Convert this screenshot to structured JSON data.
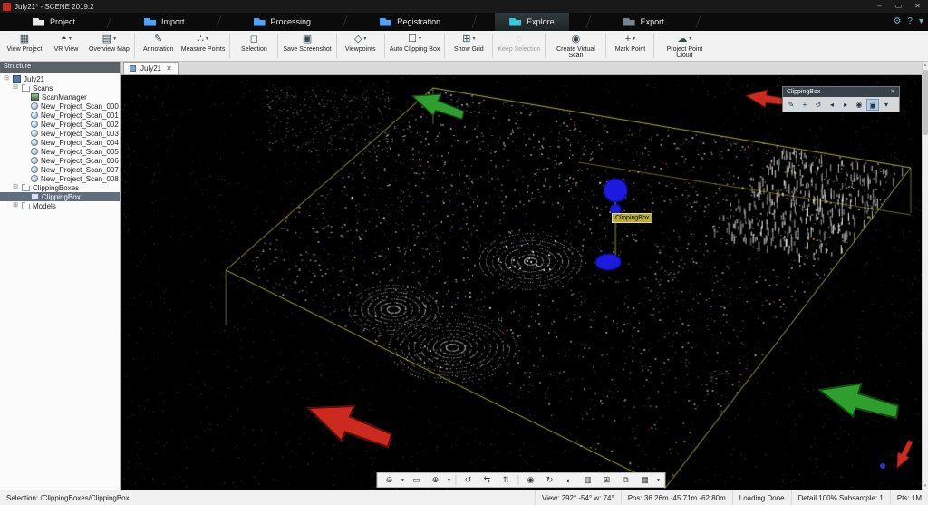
{
  "window": {
    "title": "July21* - SCENE 2019.2",
    "controls": {
      "minimize": "–",
      "maximize": "▭",
      "close": "✕"
    }
  },
  "colors": {
    "accent_cyan": "#35c8dc",
    "tab_blue": "#4da3ff",
    "arrow_green": "#2f9e2f",
    "arrow_red": "#cc2a1e",
    "clip_outline": "#cfcf4a",
    "marker_blue": "#1a1ae0",
    "selection_row": "#5f6f7d"
  },
  "ribbon": {
    "tabs": [
      {
        "label": "Project",
        "icon": "project-folder-icon",
        "accent": "#e8e8e8",
        "active": false
      },
      {
        "label": "Import",
        "icon": "import-icon",
        "accent": "#4da3ff",
        "active": false
      },
      {
        "label": "Processing",
        "icon": "processing-icon",
        "accent": "#4da3ff",
        "active": false
      },
      {
        "label": "Registration",
        "icon": "registration-icon",
        "accent": "#4da3ff",
        "active": false
      },
      {
        "label": "Explore",
        "icon": "explore-icon",
        "accent": "#35c8dc",
        "active": true
      },
      {
        "label": "Export",
        "icon": "export-icon",
        "accent": "#75828a",
        "active": false
      }
    ],
    "right_icons": [
      {
        "name": "settings-gear-icon",
        "glyph": "⚙"
      },
      {
        "name": "help-icon",
        "glyph": "?"
      },
      {
        "name": "collapse-ribbon-icon",
        "glyph": "▾"
      }
    ]
  },
  "toolbar": {
    "items": [
      {
        "label": "View Project",
        "icon": "view-project-icon",
        "glyph": "▦"
      },
      {
        "label": "VR View",
        "icon": "vr-view-icon",
        "glyph": "◓",
        "dropdown": true
      },
      {
        "label": "Overview Map",
        "icon": "overview-map-icon",
        "glyph": "▤",
        "dropdown": true
      },
      {
        "sep": true
      },
      {
        "label": "Annotation",
        "icon": "annotation-icon",
        "glyph": "✎"
      },
      {
        "label": "Measure Points",
        "icon": "measure-points-icon",
        "glyph": "∴",
        "dropdown": true
      },
      {
        "sep": true
      },
      {
        "label": "Selection",
        "icon": "selection-icon",
        "glyph": "◻"
      },
      {
        "sep": true
      },
      {
        "label": "Save Screenshot",
        "icon": "save-screenshot-icon",
        "glyph": "▣"
      },
      {
        "sep": true
      },
      {
        "label": "Viewpoints",
        "icon": "viewpoints-icon",
        "glyph": "◇",
        "dropdown": true
      },
      {
        "sep": true
      },
      {
        "label": "Auto Clipping Box",
        "icon": "auto-clipping-box-icon",
        "glyph": "☐",
        "dropdown": true
      },
      {
        "sep": true
      },
      {
        "label": "Show Grid",
        "icon": "show-grid-icon",
        "glyph": "⊞",
        "dropdown": true
      },
      {
        "sep": true
      },
      {
        "label": "Keep Selection",
        "icon": "keep-selection-icon",
        "glyph": "◌",
        "disabled": true
      },
      {
        "sep": true
      },
      {
        "label": "Create Virtual Scan",
        "icon": "create-virtual-scan-icon",
        "glyph": "◉"
      },
      {
        "sep": true
      },
      {
        "label": "Mark Point",
        "icon": "mark-point-icon",
        "glyph": "+",
        "dropdown": true
      },
      {
        "sep": true
      },
      {
        "label": "Project Point Cloud",
        "icon": "project-point-cloud-icon",
        "glyph": "☁",
        "dropdown": true
      }
    ]
  },
  "sidebar": {
    "title": "Structure",
    "tree": [
      {
        "label": "July21",
        "level": 0,
        "icon": "project-icon",
        "expander": "⊟"
      },
      {
        "label": "Scans",
        "level": 1,
        "icon": "folder-icon",
        "expander": "⊟"
      },
      {
        "label": "ScanManager",
        "level": 2,
        "icon": "scan-manager-icon"
      },
      {
        "label": "New_Project_Scan_000",
        "level": 2,
        "icon": "scan-icon"
      },
      {
        "label": "New_Project_Scan_001",
        "level": 2,
        "icon": "scan-icon"
      },
      {
        "label": "New_Project_Scan_002",
        "level": 2,
        "icon": "scan-icon"
      },
      {
        "label": "New_Project_Scan_003",
        "level": 2,
        "icon": "scan-icon"
      },
      {
        "label": "New_Project_Scan_004",
        "level": 2,
        "icon": "scan-icon"
      },
      {
        "label": "New_Project_Scan_005",
        "level": 2,
        "icon": "scan-icon"
      },
      {
        "label": "New_Project_Scan_006",
        "level": 2,
        "icon": "scan-icon"
      },
      {
        "label": "New_Project_Scan_007",
        "level": 2,
        "icon": "scan-icon"
      },
      {
        "label": "New_Project_Scan_008",
        "level": 2,
        "icon": "scan-icon"
      },
      {
        "label": "ClippingBoxes",
        "level": 1,
        "icon": "folder-icon",
        "expander": "⊟"
      },
      {
        "label": "ClippingBox",
        "level": 2,
        "icon": "clipping-box-icon",
        "selected": true
      },
      {
        "label": "Models",
        "level": 1,
        "icon": "folder-icon",
        "expander": "⊞"
      }
    ]
  },
  "viewport": {
    "tab": {
      "label": "July21",
      "close": "✕"
    },
    "marker_label": "ClippingBox",
    "clipping_panel": {
      "title": "ClippingBox",
      "close": "✕",
      "icons": [
        {
          "name": "edit-clipping-icon",
          "glyph": "✎"
        },
        {
          "name": "translate-clipping-icon",
          "glyph": "+"
        },
        {
          "name": "rotate-clipping-icon",
          "glyph": "↺"
        },
        {
          "name": "prev-face-icon",
          "glyph": "◂"
        },
        {
          "name": "next-face-icon",
          "glyph": "▸"
        },
        {
          "name": "visibility-icon",
          "glyph": "◉"
        },
        {
          "name": "apply-clipping-icon",
          "glyph": "▣",
          "hl": true
        },
        {
          "name": "panel-menu-icon",
          "glyph": "▾"
        }
      ]
    },
    "nav_toolbar": [
      {
        "name": "zoom-out-icon",
        "glyph": "⊖"
      },
      {
        "name": "zoom-mode-dropdown",
        "glyph": "▾",
        "caret": true
      },
      {
        "name": "fit-view-icon",
        "glyph": "▭"
      },
      {
        "name": "zoom-in-icon",
        "glyph": "⊕"
      },
      {
        "name": "zoom-window-dropdown",
        "glyph": "▾",
        "caret": true
      },
      {
        "sep": true
      },
      {
        "name": "rotate-view-icon",
        "glyph": "↺"
      },
      {
        "name": "pan-view-icon",
        "glyph": "⇆"
      },
      {
        "name": "dolly-view-icon",
        "glyph": "⇅"
      },
      {
        "sep": true
      },
      {
        "name": "examine-mode-icon",
        "glyph": "◉"
      },
      {
        "name": "walk-mode-icon",
        "glyph": "↻"
      },
      {
        "name": "split-view-icon",
        "glyph": "◐"
      },
      {
        "name": "color-mode-icon",
        "glyph": "▥"
      },
      {
        "name": "projection-icon",
        "glyph": "⊞"
      },
      {
        "name": "fullscreen-icon",
        "glyph": "⧉"
      },
      {
        "name": "view-options-icon",
        "glyph": "▦"
      },
      {
        "name": "view-options-dropdown",
        "glyph": "▾",
        "caret": true
      }
    ],
    "scrollbar": {
      "up": "▴",
      "down": "▾"
    }
  },
  "statusbar": {
    "selection": "Selection: /ClippingBoxes/ClippingBox",
    "view": "View: 292° -54° w: 74°",
    "pos": "Pos: 36.26m -45.71m -62.80m",
    "loading": "Loading Done",
    "detail": "Detail 100%   Subsample: 1",
    "pts": "Pts:  1M"
  }
}
